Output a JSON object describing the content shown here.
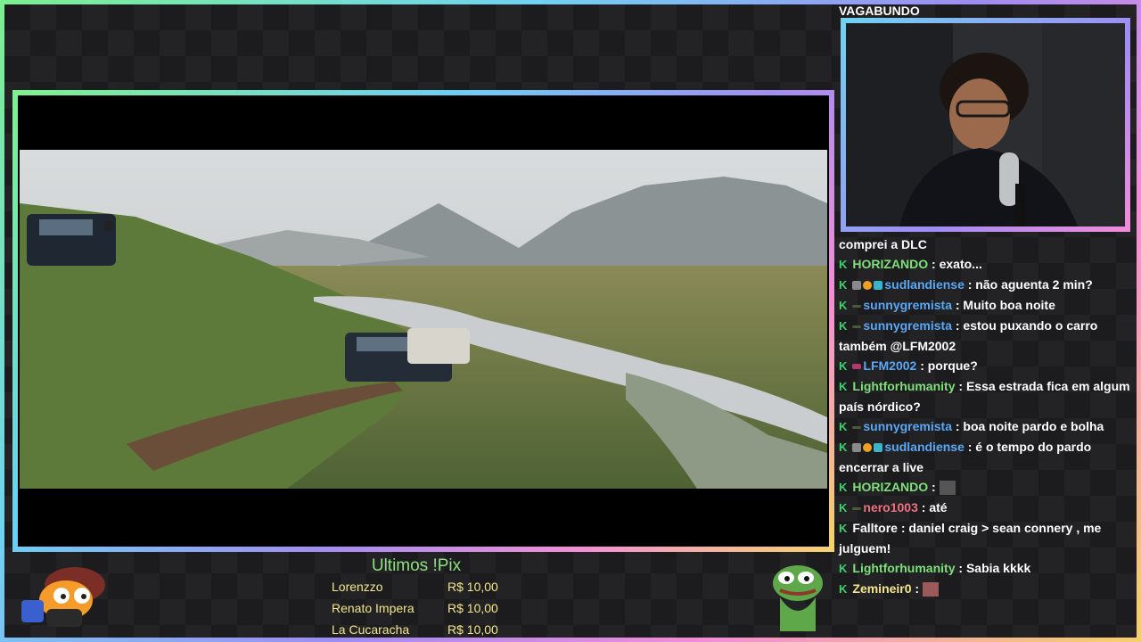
{
  "chat": {
    "owner": "VAGABUNDO",
    "messages": [
      {
        "user": "",
        "text": "comprei a DLC",
        "color": "#ffffff",
        "badges": []
      },
      {
        "user": "HORIZANDO",
        "text": " : exato...",
        "color": "#7ee07a",
        "badges": [
          "K"
        ]
      },
      {
        "user": "sudlandiense",
        "text": " : não aguenta 2 min?",
        "color": "#5aa8f5",
        "badges": [
          "K",
          "controller",
          "1",
          "gift"
        ]
      },
      {
        "user": "sunnygremista",
        "text": " : Muito boa noite",
        "color": "#5aa8f5",
        "badges": [
          "K",
          "dash"
        ]
      },
      {
        "user": "sunnygremista",
        "text": " : estou puxando o carro também @LFM2002",
        "color": "#5aa8f5",
        "badges": [
          "K",
          "dash"
        ]
      },
      {
        "user": "LFM2002",
        "text": " : porque?",
        "color": "#5aa8f5",
        "badges": [
          "K",
          "crown"
        ]
      },
      {
        "user": "Lightforhumanity",
        "text": " : Essa estrada fica em algum país nórdico?",
        "color": "#7ee07a",
        "badges": [
          "K"
        ]
      },
      {
        "user": "sunnygremista",
        "text": " : boa noite pardo e bolha",
        "color": "#5aa8f5",
        "badges": [
          "K",
          "dash"
        ]
      },
      {
        "user": "sudlandiense",
        "text": " : é o tempo do pardo encerrar a live",
        "color": "#5aa8f5",
        "badges": [
          "K",
          "controller",
          "1",
          "gift"
        ]
      },
      {
        "user": "HORIZANDO",
        "text": " : ",
        "color": "#7ee07a",
        "badges": [
          "K"
        ],
        "emote": "gray"
      },
      {
        "user": "nero1003",
        "text": " : até",
        "color": "#f07080",
        "badges": [
          "K",
          "dash"
        ]
      },
      {
        "user": "Falltore",
        "text": " : daniel craig > sean connery , me julguem!",
        "color": "#ffffff",
        "badges": [
          "K"
        ]
      },
      {
        "user": "Lightforhumanity",
        "text": " : Sabia kkkk",
        "color": "#7ee07a",
        "badges": [
          "K"
        ]
      },
      {
        "user": "Zemineir0",
        "text": " : ",
        "color": "#f4e68c",
        "badges": [
          "K"
        ],
        "emote": "pink"
      }
    ]
  },
  "pix": {
    "title": "Ultimos !Pix",
    "rows": [
      {
        "name": "Lorenzzo",
        "amount": "R$ 10,00"
      },
      {
        "name": "Renato Impera",
        "amount": "R$ 10,00"
      },
      {
        "name": "La Cucaracha",
        "amount": "R$ 10,00"
      }
    ]
  },
  "colors": {
    "k_badge": "#3bd26b",
    "pix_title": "#8de07d",
    "pix_text": "#f4e68c"
  },
  "icons": {
    "left_emote": "character-emote-icon",
    "right_emote": "pepe-frog-icon"
  }
}
